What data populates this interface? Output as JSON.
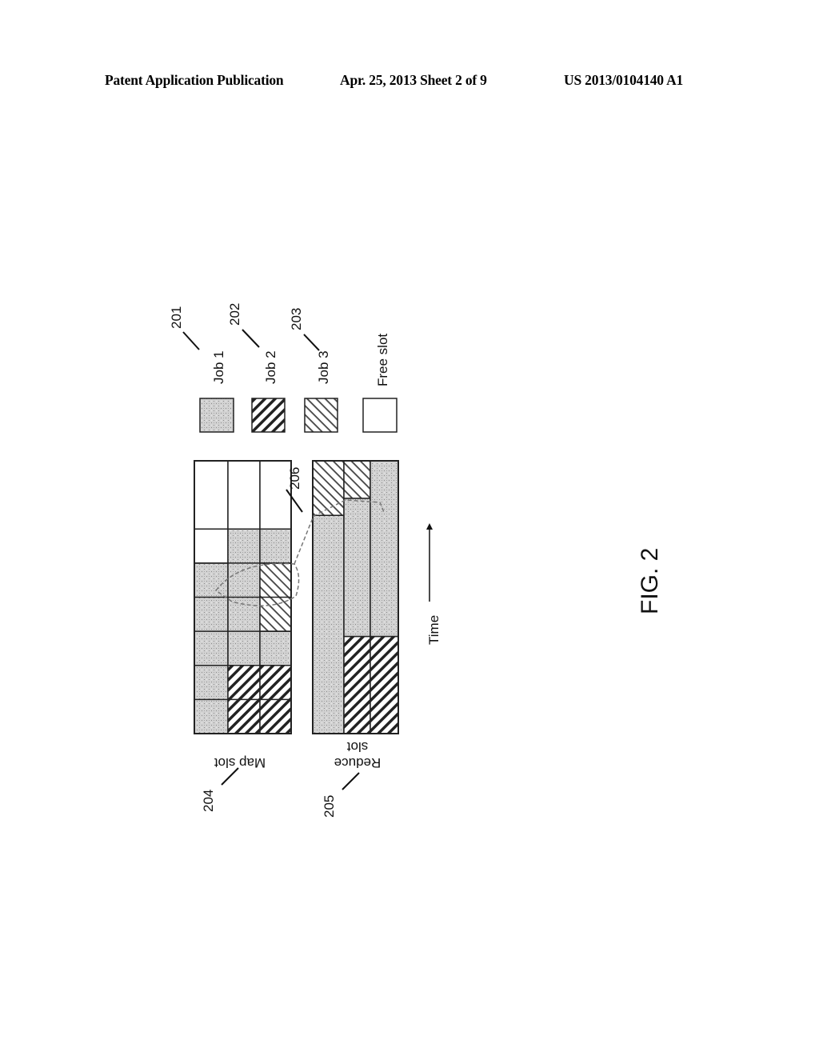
{
  "header": {
    "publication": "Patent Application Publication",
    "date_sheet": "Apr. 25, 2013  Sheet 2 of 9",
    "patent_number": "US 2013/0104140 A1"
  },
  "figure": {
    "label": "FIG. 2",
    "time_axis_label": "Time",
    "legend": [
      {
        "ref": "201",
        "label": "Job 1",
        "pattern": "job1"
      },
      {
        "ref": "202",
        "label": "Job 2",
        "pattern": "job2"
      },
      {
        "ref": "203",
        "label": "Job 3",
        "pattern": "job3"
      },
      {
        "ref": "",
        "label": "Free slot",
        "pattern": "free"
      }
    ],
    "map_slot": {
      "ref": "204",
      "label": "Map slot",
      "time_units": 8,
      "rows": [
        {
          "segments": [
            {
              "job": "job1",
              "from": 0,
              "to": 5
            },
            {
              "job": "free",
              "from": 5,
              "to": 8
            }
          ]
        },
        {
          "segments": [
            {
              "job": "job2",
              "from": 0,
              "to": 2
            },
            {
              "job": "job1",
              "from": 2,
              "to": 6
            },
            {
              "job": "free",
              "from": 6,
              "to": 8
            }
          ]
        },
        {
          "segments": [
            {
              "job": "job2",
              "from": 0,
              "to": 2
            },
            {
              "job": "job1",
              "from": 2,
              "to": 3
            },
            {
              "job": "job3",
              "from": 3,
              "to": 5
            },
            {
              "job": "job1",
              "from": 5,
              "to": 6
            },
            {
              "job": "free",
              "from": 6,
              "to": 8
            }
          ]
        }
      ],
      "cell_boundaries": [
        1,
        2,
        3,
        4,
        5,
        6
      ]
    },
    "reduce_slot": {
      "ref": "205",
      "label_line1": "Reduce",
      "label_line2": "slot",
      "time_units": 8,
      "rows": [
        {
          "segments": [
            {
              "job": "job1",
              "from": 0,
              "to": 6.4
            },
            {
              "job": "job3",
              "from": 6.4,
              "to": 8
            }
          ]
        },
        {
          "segments": [
            {
              "job": "job2",
              "from": 0,
              "to": 2.85
            },
            {
              "job": "job1",
              "from": 2.85,
              "to": 6.9
            },
            {
              "job": "job3",
              "from": 6.9,
              "to": 8
            }
          ]
        },
        {
          "segments": [
            {
              "job": "job2",
              "from": 0,
              "to": 2.85
            },
            {
              "job": "job1",
              "from": 2.85,
              "to": 8
            }
          ]
        }
      ]
    },
    "callout": {
      "ref": "206"
    }
  }
}
